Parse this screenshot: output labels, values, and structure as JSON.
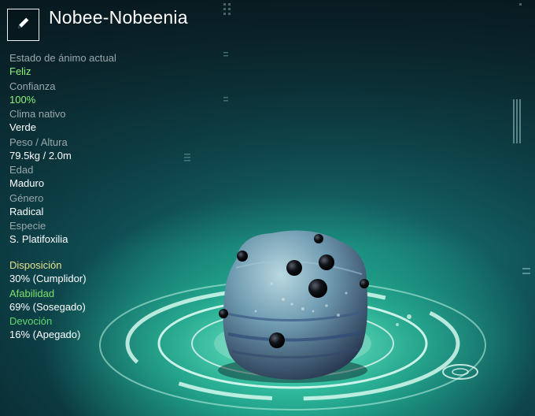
{
  "creature": {
    "name": "Nobee-Nobeenia"
  },
  "icons": {
    "edit": "pencil-icon"
  },
  "stats": [
    {
      "label": "Estado de ánimo actual",
      "value": "Feliz",
      "highlight": true
    },
    {
      "label": "Confianza",
      "value": "100%",
      "highlight": true
    },
    {
      "label": "Clima nativo",
      "value": "Verde",
      "highlight": false
    },
    {
      "label": "Peso / Altura",
      "value": "79.5kg / 2.0m",
      "highlight": false
    },
    {
      "label": "Edad",
      "value": "Maduro",
      "highlight": false
    },
    {
      "label": "Género",
      "value": "Radical",
      "highlight": false
    },
    {
      "label": "Especie",
      "value": "S. Platifoxilia",
      "highlight": false
    }
  ],
  "traits": [
    {
      "label": "Disposición",
      "value": "30% (Cumplidor)",
      "color": "#e6e08a"
    },
    {
      "label": "Afabilidad",
      "value": "69% (Sosegado)",
      "color": "#7ee06a"
    },
    {
      "label": "Devoción",
      "value": "16% (Apegado)",
      "color": "#5fd86a"
    }
  ],
  "colors": {
    "accent_green": "#8ef27a",
    "label_gray": "#9aa8ab",
    "text_white": "#ffffff"
  }
}
